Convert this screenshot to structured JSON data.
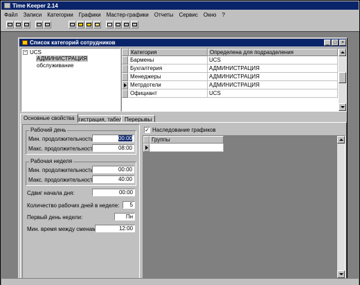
{
  "app": {
    "title": "Time Keeper 2.14"
  },
  "menu": [
    "Файл",
    "Записи",
    "Категории",
    "Графики",
    "Мастер-графики",
    "Отчеты",
    "Сервис",
    "Окно",
    "?"
  ],
  "child_window": {
    "title": "Список категорий сотрудников",
    "buttons": {
      "minimize": "_",
      "maximize": "□",
      "close": "×"
    }
  },
  "tree": {
    "root": "UCS",
    "root_toggle": "−",
    "children": [
      "АДМИНИСТРАЦИЯ",
      "обслуживание"
    ]
  },
  "grid": {
    "columns": [
      "Категория",
      "Определена для подразделения"
    ],
    "rows": [
      [
        "Бармены",
        "UCS"
      ],
      [
        "Бухгалтерия",
        "АДМИНИСТРАЦИЯ"
      ],
      [
        "Менеджеры",
        "АДМИНИСТРАЦИЯ"
      ],
      [
        "Метрдотели",
        "АДМИНИСТРАЦИЯ"
      ],
      [
        "Официант",
        "UCS"
      ]
    ]
  },
  "tabs": [
    "Основные свойства",
    "Регистрация, табель",
    "Перерывы"
  ],
  "props": {
    "work_day": {
      "legend": "Рабочий день",
      "min_label": "Мин. продолжительность:",
      "min_value": "00:00",
      "max_label": "Макс. продолжительность:",
      "max_value": "08:00"
    },
    "work_week": {
      "legend": "Рабочая неделя",
      "min_label": "Мин. продолжительность:",
      "min_value": "00:00",
      "max_label": "Макс. продолжительность:",
      "max_value": "40:00"
    },
    "day_shift_label": "Сдвиг начала дня:",
    "day_shift_value": "00:00",
    "work_days_label": "Количество рабочих дней в неделе:",
    "work_days_value": "5",
    "first_day_label": "Первый день недели:",
    "first_day_value": "Пн",
    "min_time_label": "Мин. время между сменами:",
    "min_time_value": "12:00"
  },
  "schedule": {
    "checkbox_label": "Наследование графиков",
    "checkbox_mark": "✓",
    "column": "Группы"
  }
}
